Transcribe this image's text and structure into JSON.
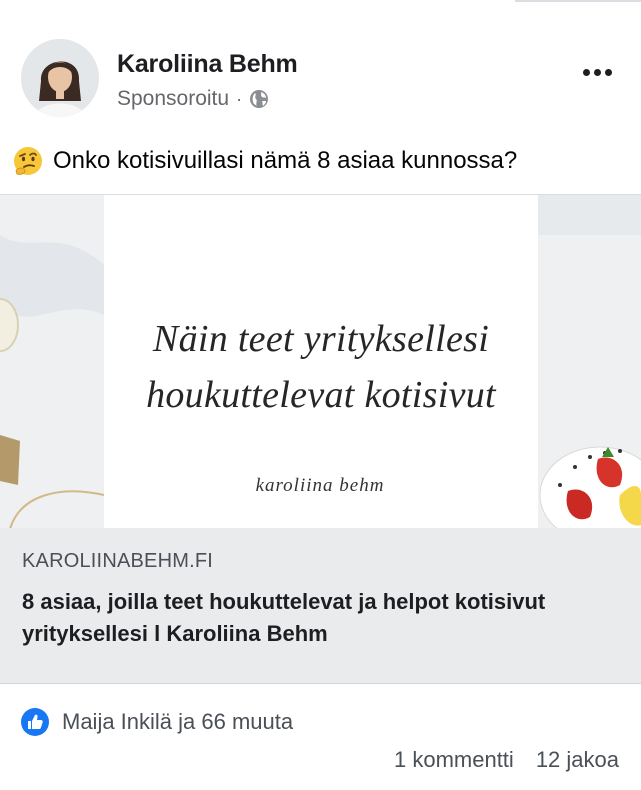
{
  "post": {
    "author_name": "Karoliina Behm",
    "sponsored_label": "Sponsoroitu",
    "separator": "·",
    "caption": "Onko kotisivuillasi nämä 8 asiaa kunnossa?"
  },
  "link_preview": {
    "image_headline_line1": "Näin teet yrityksellesi",
    "image_headline_line2": "houkuttelevat kotisivut",
    "image_signature": "karoliina behm",
    "domain": "KAROLIINABEHM.FI",
    "title": "8 asiaa, joilla teet houkuttelevat ja helpot kotisivut yrityksellesi l Karoliina Behm"
  },
  "engagement": {
    "reactions_text": "Maija Inkilä ja 66 muuta",
    "comments_text": "1 kommentti",
    "shares_text": "12 jakoa"
  },
  "icons": {
    "more": "more-options-icon",
    "audience": "globe-icon",
    "emoji": "thinking-face-emoji",
    "reaction": "like-icon"
  },
  "colors": {
    "like_blue": "#1877f2",
    "secondary_text": "#65676b",
    "card_info_bg": "#eaebed"
  }
}
